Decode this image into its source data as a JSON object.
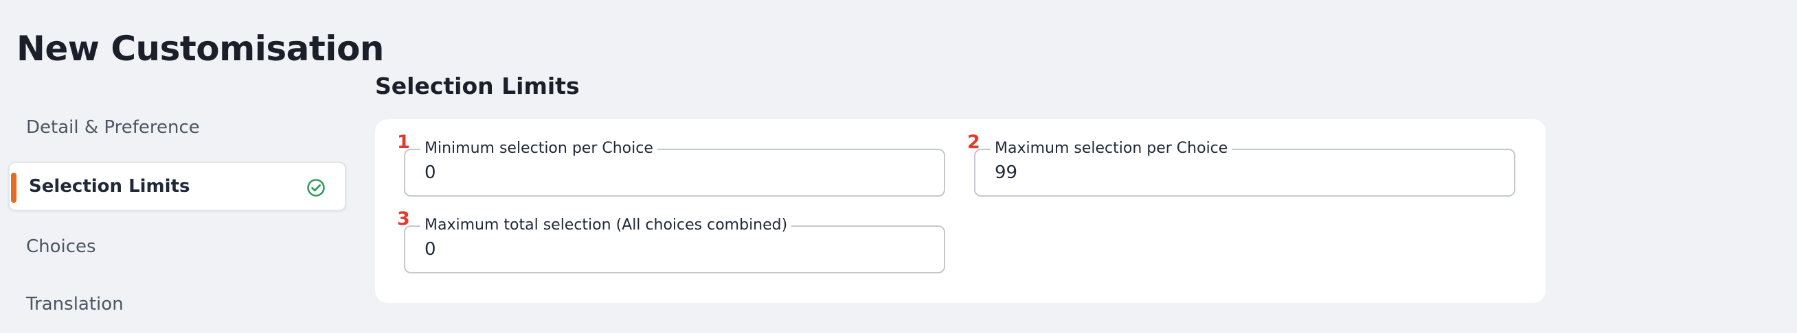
{
  "page": {
    "title": "New Customisation"
  },
  "sidebar": {
    "items": [
      {
        "label": "Detail & Preference",
        "active": false
      },
      {
        "label": "Selection Limits",
        "active": true,
        "status_icon": "check-circle-icon"
      },
      {
        "label": "Choices",
        "active": false
      },
      {
        "label": "Translation",
        "active": false
      }
    ]
  },
  "section": {
    "title": "Selection Limits"
  },
  "fields": [
    {
      "marker": "1",
      "label": "Minimum selection per Choice",
      "value": "0"
    },
    {
      "marker": "2",
      "label": "Maximum selection per Choice",
      "value": "99"
    },
    {
      "marker": "3",
      "label": "Maximum total selection (All choices combined)",
      "value": "0"
    }
  ],
  "colors": {
    "background": "#f1f2f5",
    "accent": "#e56a24",
    "success": "#2e9e5b",
    "marker": "#e23b2e"
  }
}
